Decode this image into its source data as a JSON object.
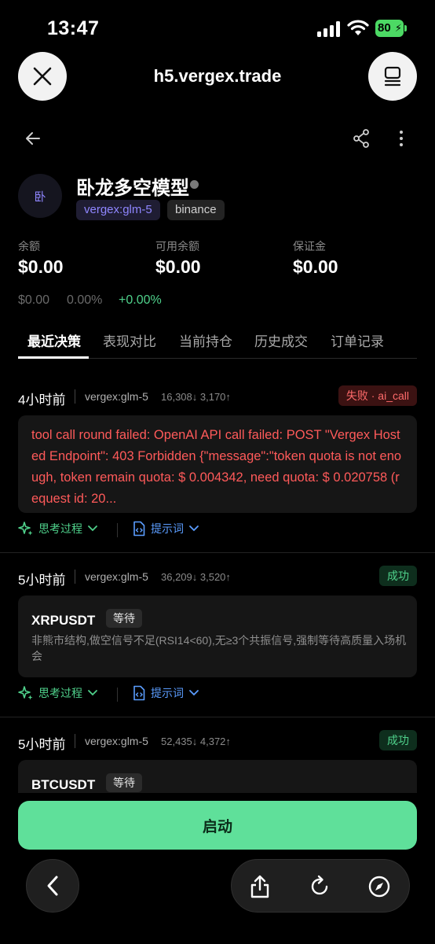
{
  "status_bar": {
    "time": "13:47",
    "battery": "80"
  },
  "browser": {
    "url": "h5.vergex.trade"
  },
  "profile": {
    "avatar_text": "卧",
    "name": "卧龙多空模型",
    "model_tag": "vergex:glm-5",
    "exchange_tag": "binance"
  },
  "balances": [
    {
      "label": "余额",
      "value": "$0.00"
    },
    {
      "label": "可用余额",
      "value": "$0.00"
    },
    {
      "label": "保证金",
      "value": "$0.00"
    }
  ],
  "sub_stats": {
    "pnl": "$0.00",
    "pnl_pct": "0.00%",
    "change": "+0.00%"
  },
  "tabs": [
    "最近决策",
    "表现对比",
    "当前持仓",
    "历史成交",
    "订单记录"
  ],
  "decisions": [
    {
      "time": "4小时前",
      "model": "vergex:glm-5",
      "tokens": "16,308↓ 3,170↑",
      "status": "失败 · ai_call",
      "error": "tool call round failed: OpenAI API call failed: POST \"Vergex Hosted Endpoint\": 403 Forbidden {\"message\":\"token quota is not enough, token remain quota:  $ 0.004342, need quota:  $ 0.020758 (request id: 20..."
    },
    {
      "time": "5小时前",
      "model": "vergex:glm-5",
      "tokens": "36,209↓ 3,520↑",
      "status": "成功",
      "symbol": "XRPUSDT",
      "action": "等待",
      "reason": "非熊市结构,做空信号不足(RSI14<60),无≥3个共振信号,强制等待高质量入场机会"
    },
    {
      "time": "5小时前",
      "model": "vergex:glm-5",
      "tokens": "52,435↓ 4,372↑",
      "status": "成功",
      "symbol": "BTCUSDT",
      "action": "等待"
    }
  ],
  "actions": {
    "think": "思考过程",
    "prompt": "提示词"
  },
  "start_button": "启动",
  "colors": {
    "accent_green": "#5fe09a",
    "fail_red": "#ff5a5a",
    "prompt_blue": "#5b9dff",
    "model_purple": "#8f86ff"
  }
}
